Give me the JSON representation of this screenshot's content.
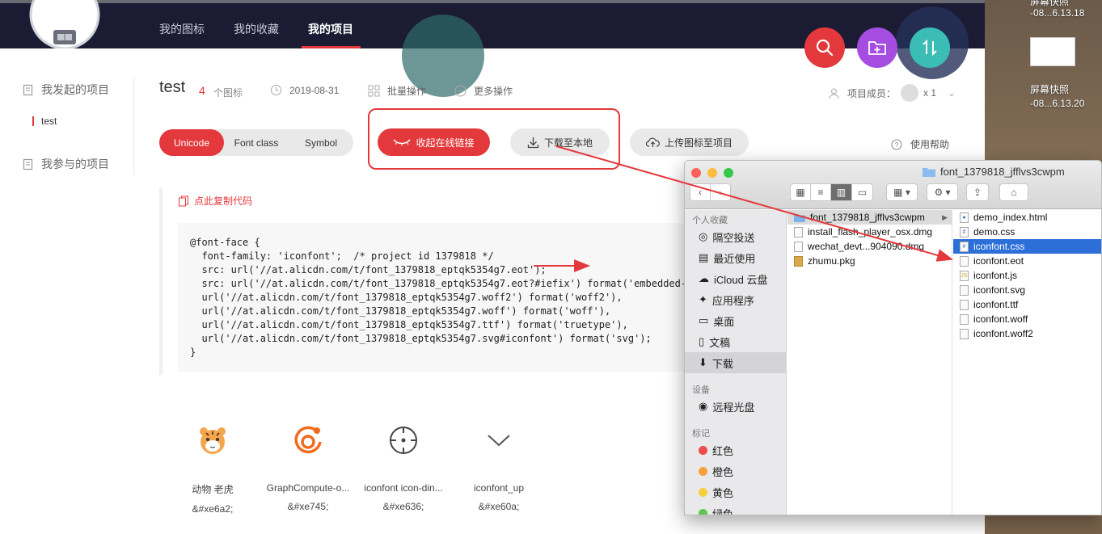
{
  "desktop": {
    "captions": [
      "屏幕快照",
      "-08...6.13.18",
      "屏幕快照",
      "-08...6.13.20"
    ]
  },
  "nav": {
    "tabs": [
      "我的图标",
      "我的收藏",
      "我的项目"
    ],
    "active_tab": "我的项目"
  },
  "actions": {
    "search_icon": "search-icon",
    "add_folder_icon": "folder-plus-icon",
    "sort_icon": "sort-icon",
    "colors": {
      "search": "#e4393c",
      "folder": "#a44de0",
      "sort": "#3bbcb4"
    }
  },
  "sidebar": {
    "initiated": "我发起的项目",
    "project": "test",
    "joined": "我参与的项目"
  },
  "project": {
    "name": "test",
    "count": "4",
    "count_unit": "个图标",
    "date": "2019-08-31",
    "batch": "批量操作",
    "more": "更多操作",
    "members_label": "项目成员：",
    "members_count": "x 1"
  },
  "buttons": {
    "unicode": "Unicode",
    "font_class": "Font class",
    "symbol": "Symbol",
    "collapse_link": "收起在线链接",
    "download": "下载至本地",
    "upload": "上传图标至项目",
    "help": "使用帮助"
  },
  "code": {
    "copy_label": "点此复制代码",
    "text": "@font-face {\n  font-family: 'iconfont';  /* project id 1379818 */\n  src: url('//at.alicdn.com/t/font_1379818_eptqk5354g7.eot');\n  src: url('//at.alicdn.com/t/font_1379818_eptqk5354g7.eot?#iefix') format('embedded-\n  url('//at.alicdn.com/t/font_1379818_eptqk5354g7.woff2') format('woff2'),\n  url('//at.alicdn.com/t/font_1379818_eptqk5354g7.woff') format('woff'),\n  url('//at.alicdn.com/t/font_1379818_eptqk5354g7.ttf') format('truetype'),\n  url('//at.alicdn.com/t/font_1379818_eptqk5354g7.svg#iconfont') format('svg');\n}"
  },
  "icons": [
    {
      "name": "动物 老虎",
      "code": "&#xe6a2;"
    },
    {
      "name": "GraphCompute-o...",
      "code": "&#xe745;"
    },
    {
      "name": "iconfont icon-din...",
      "code": "&#xe636;"
    },
    {
      "name": "iconfont_up",
      "code": "&#xe60a;"
    }
  ],
  "finder": {
    "title": "font_1379818_jfflvs3cwpm",
    "favorites_header": "个人收藏",
    "favorites": [
      "隔空投送",
      "最近使用",
      "iCloud 云盘",
      "应用程序",
      "桌面",
      "文稿",
      "下载"
    ],
    "devices_header": "设备",
    "devices": [
      "远程光盘"
    ],
    "tags_header": "标记",
    "tags": [
      {
        "name": "红色",
        "color": "#f04b4b"
      },
      {
        "name": "橙色",
        "color": "#f6a03a"
      },
      {
        "name": "黄色",
        "color": "#f5d03c"
      },
      {
        "name": "绿色",
        "color": "#5bc84d"
      }
    ],
    "column1": [
      "font_1379818_jfflvs3cwpm",
      "install_flash_player_osx.dmg",
      "wechat_devt...904090.dmg",
      "zhumu.pkg"
    ],
    "column2": [
      "demo_index.html",
      "demo.css",
      "iconfont.css",
      "iconfont.eot",
      "iconfont.js",
      "iconfont.svg",
      "iconfont.ttf",
      "iconfont.woff",
      "iconfont.woff2"
    ]
  }
}
